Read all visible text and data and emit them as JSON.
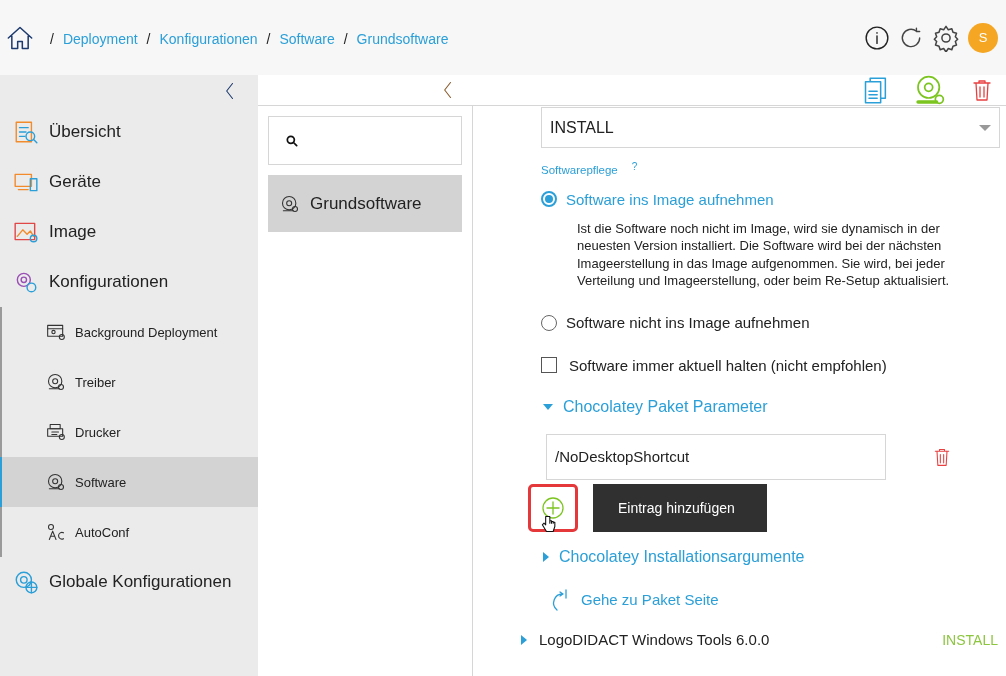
{
  "breadcrumb": [
    {
      "separator": "/",
      "label": "Deployment"
    },
    {
      "separator": "/",
      "label": "Konfigurationen"
    },
    {
      "separator": "/",
      "label": "Software"
    },
    {
      "separator": "/",
      "label": "Grundsoftware"
    }
  ],
  "user": {
    "initial": "S"
  },
  "sidebar": {
    "items": [
      {
        "label": "Übersicht",
        "selected": false
      },
      {
        "label": "Geräte",
        "selected": false
      },
      {
        "label": "Image",
        "selected": false
      },
      {
        "label": "Konfigurationen",
        "selected": false,
        "children": [
          {
            "label": "Background Deployment",
            "selected": false
          },
          {
            "label": "Treiber",
            "selected": false
          },
          {
            "label": "Drucker",
            "selected": false
          },
          {
            "label": "Software",
            "selected": true
          },
          {
            "label": "AutoConf",
            "selected": false
          }
        ]
      },
      {
        "label": "Globale Konfigurationen",
        "selected": false
      }
    ]
  },
  "list": {
    "items": [
      {
        "label": "Grundsoftware",
        "selected": true
      }
    ]
  },
  "detail": {
    "install_select": {
      "value": "INSTALL"
    },
    "softwarepflege": {
      "label": "Softwarepflege",
      "help": "?",
      "options": [
        {
          "label": "Software ins Image aufnehmen",
          "selected": true,
          "description": "Ist die Software noch nicht im Image, wird sie dynamisch in der neuesten Version installiert. Die Software wird bei der nächsten Imageerstellung in das Image aufgenommen. Sie wird, bei jeder Verteilung und Imageerstellung, oder beim Re-Setup aktualisiert."
        },
        {
          "label": "Software nicht ins Image aufnehmen",
          "selected": false
        }
      ]
    },
    "always_update": {
      "label": "Software immer aktuell halten (nicht empfohlen)",
      "checked": false
    },
    "sections": [
      {
        "title": "Chocolatey Paket Parameter",
        "expanded": true,
        "params": [
          "/NoDesktopShortcut"
        ]
      },
      {
        "title": "Chocolatey Installationsargumente",
        "expanded": false
      }
    ],
    "add_tooltip": "Eintrag hinzufügen",
    "package_link": "Gehe zu Paket Seite"
  },
  "packages": [
    {
      "name": "LogoDIDACT Windows Tools 6.0.0",
      "action": "INSTALL",
      "expanded": false
    }
  ]
}
